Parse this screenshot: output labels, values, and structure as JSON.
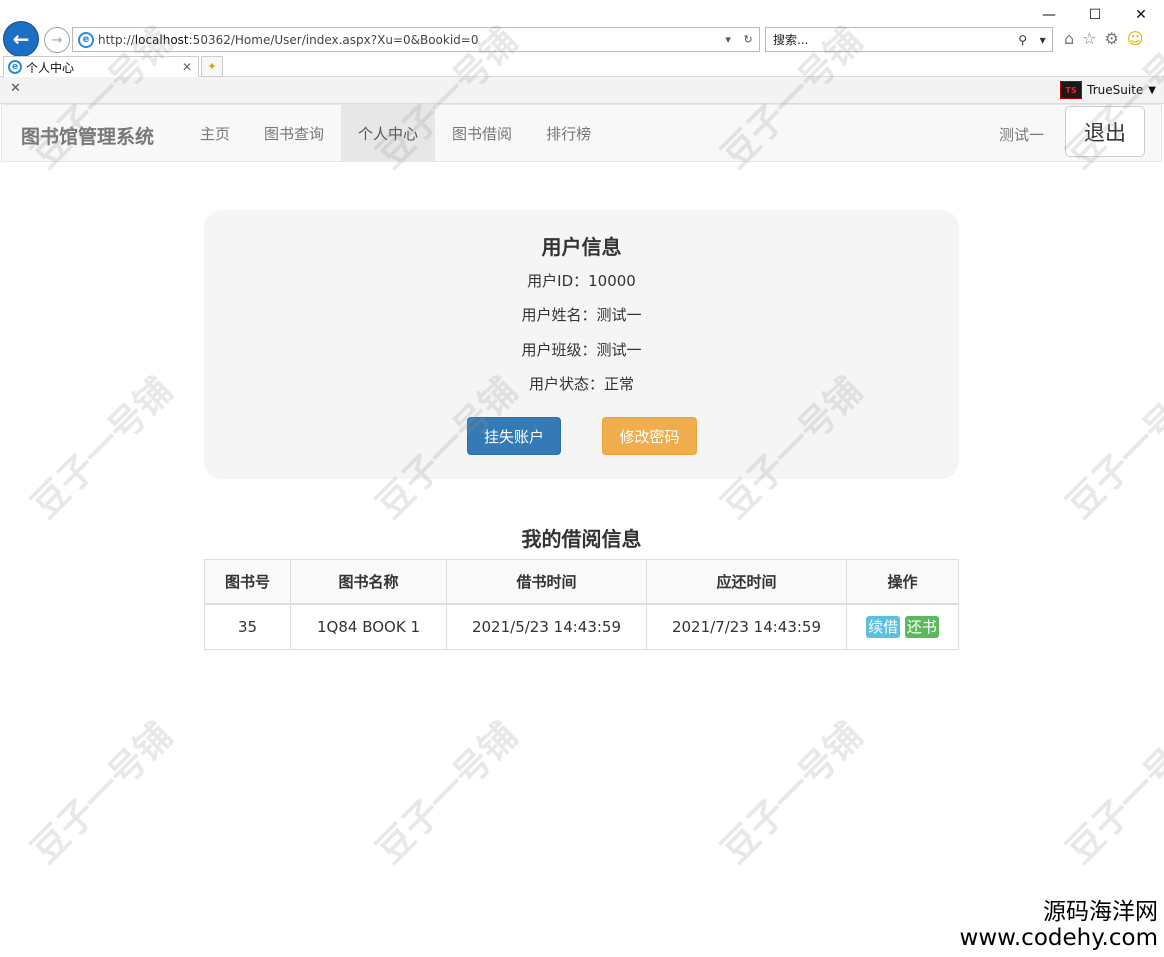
{
  "browser": {
    "url_prefix": "http://",
    "url_host": "localhost",
    "url_rest": ":50362/Home/User/index.aspx?Xu=0&Bookid=0",
    "search_placeholder": "搜索...",
    "tab_title": "个人中心",
    "toolbar_extension": "TrueSuite"
  },
  "navbar": {
    "brand": "图书馆管理系统",
    "items": [
      "主页",
      "图书查询",
      "个人中心",
      "图书借阅",
      "排行榜"
    ],
    "active_index": 2,
    "user_name": "测试一",
    "logout_label": "退出"
  },
  "user_info": {
    "title": "用户信息",
    "id_line": "用户ID：10000",
    "name_line": "用户姓名：测试一",
    "class_line": "用户班级：测试一",
    "status_line": "用户状态：正常",
    "report_loss_label": "挂失账户",
    "change_password_label": "修改密码"
  },
  "borrow": {
    "title": "我的借阅信息",
    "headers": [
      "图书号",
      "图书名称",
      "借书时间",
      "应还时间",
      "操作"
    ],
    "rows": [
      {
        "book_id": "35",
        "book_name": "1Q84 BOOK 1",
        "borrow_time": "2021/5/23 14:43:59",
        "due_time": "2021/7/23 14:43:59",
        "renew_label": "续借",
        "return_label": "还书"
      }
    ]
  },
  "watermark": {
    "text": "豆子一号铺",
    "corner_line1": "源码海洋网",
    "corner_line2": "www.codehy.com"
  },
  "colors": {
    "primary": "#337ab7",
    "warning": "#f0ad4e",
    "info": "#5bc0de",
    "success": "#5cb85c"
  }
}
